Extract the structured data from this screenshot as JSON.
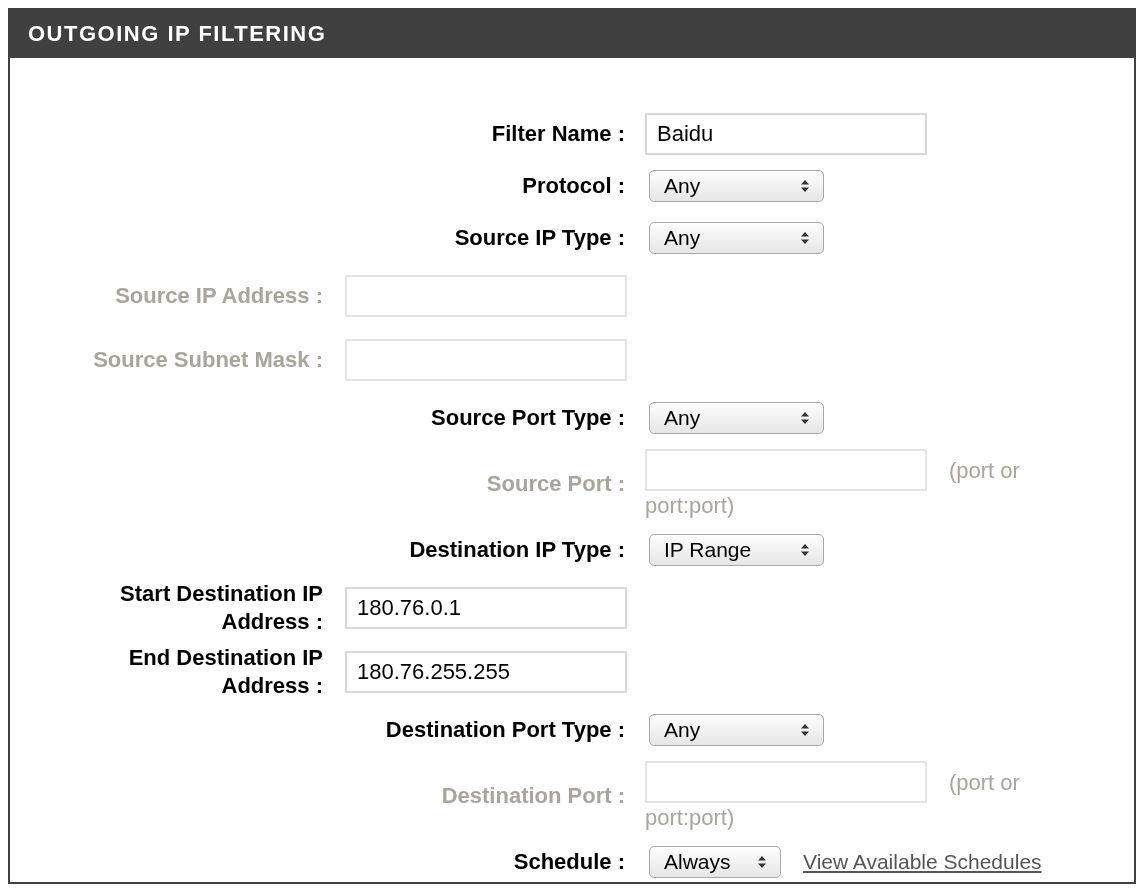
{
  "header": {
    "title": "OUTGOING IP FILTERING"
  },
  "rows": [
    {
      "kind": "text",
      "label": "Filter Name :",
      "value": "Baidu",
      "disabled": false
    },
    {
      "kind": "select",
      "label": "Protocol :",
      "value": "Any"
    },
    {
      "kind": "select",
      "label": "Source IP Type :",
      "value": "Any"
    },
    {
      "kind": "address",
      "label": "Source IP Address :",
      "disabled": true
    },
    {
      "kind": "address",
      "label": "Source Subnet Mask :",
      "disabled": true
    },
    {
      "kind": "select",
      "label": "Source Port Type :",
      "value": "Any"
    },
    {
      "kind": "port",
      "label": "Source Port :",
      "hint": [
        "(port or",
        "port:port)"
      ],
      "disabled": true
    },
    {
      "kind": "select",
      "label": "Destination IP Type :",
      "value": "IP Range"
    },
    {
      "kind": "address",
      "label": "Start Destination IP Address :",
      "value": "180.76.0.1",
      "disabled": false
    },
    {
      "kind": "address",
      "label": "End Destination IP Address :",
      "value": "180.76.255.255",
      "disabled": false
    },
    {
      "kind": "select",
      "label": "Destination Port Type :",
      "value": "Any"
    },
    {
      "kind": "port",
      "label": "Destination Port :",
      "hint": [
        "(port or",
        "port:port)"
      ],
      "disabled": true
    },
    {
      "kind": "select",
      "label": "Schedule :",
      "value": "Always",
      "link": "View Available Schedules"
    }
  ]
}
